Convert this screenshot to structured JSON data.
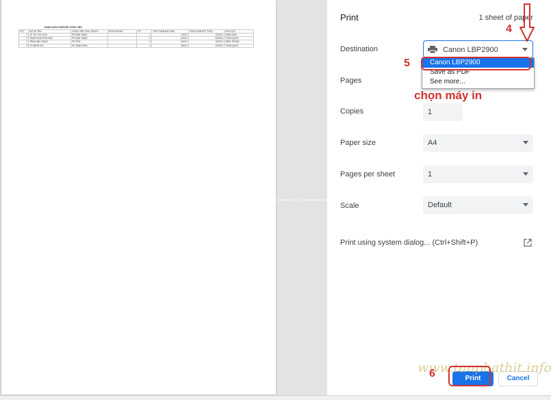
{
  "preview": {
    "table": {
      "title": "DANH SÁCH PHÂN BỔ CÔNG VIỆC",
      "headers": [
        "STT",
        "HỌ VÀ TÊN",
        "CÔNG VIỆC PHỤ TRÁCH",
        "ĐƠN PHÒNG",
        "TỔ",
        "THỜI GIAN BẮT ĐẦU",
        "THỜI GIAN KẾT THÚC",
        "KHU VỰC"
      ],
      "rows": [
        [
          "1",
          "LÊ THỊ THU HÒA",
          "PR BÁN HÀNG",
          "",
          "1",
          "1/2021",
          "12/2021",
          "MIỀN NAM"
        ],
        [
          "2",
          "TRẦN HOÀI PHƯƠNG",
          "PR BÁN HÀNG",
          "",
          "2",
          "3/2021",
          "12/2021",
          "TOÀN QUỐC"
        ],
        [
          "3",
          "TRẦN ANH SANG",
          "PR TRỰ",
          "",
          "3",
          "3/2021",
          "12/2021",
          "MIỀN TRUNG"
        ],
        [
          "4",
          "VÕ MINH HẢI",
          "PR SẢNG ĐẦU",
          "",
          "4",
          "3/2021",
          "12/2021",
          "TOÀN QUỐC"
        ]
      ]
    }
  },
  "panel": {
    "title": "Print",
    "sheets": "1 sheet of paper",
    "destination": {
      "label": "Destination",
      "value": "Canon LBP2900",
      "icon": "printer-icon",
      "options": [
        "Canon LBP2900",
        "Save as PDF",
        "See more..."
      ]
    },
    "pages": {
      "label": "Pages"
    },
    "copies": {
      "label": "Copies",
      "value": "1"
    },
    "paper_size": {
      "label": "Paper size",
      "value": "A4"
    },
    "pages_per_sheet": {
      "label": "Pages per sheet",
      "value": "1"
    },
    "scale": {
      "label": "Scale",
      "value": "Default"
    },
    "system_dialog": "Print using system dialog... (Ctrl+Shift+P)",
    "print_button": "Print",
    "cancel_button": "Cancel"
  },
  "annotations": {
    "step4": "4",
    "step5": "5",
    "step6": "6",
    "note": "chọn máy in",
    "color": "#d32f2f"
  },
  "watermark": "www.tanphathit.info",
  "colors": {
    "accent": "#1a73e8",
    "select_bg": "#f1f3f4"
  }
}
